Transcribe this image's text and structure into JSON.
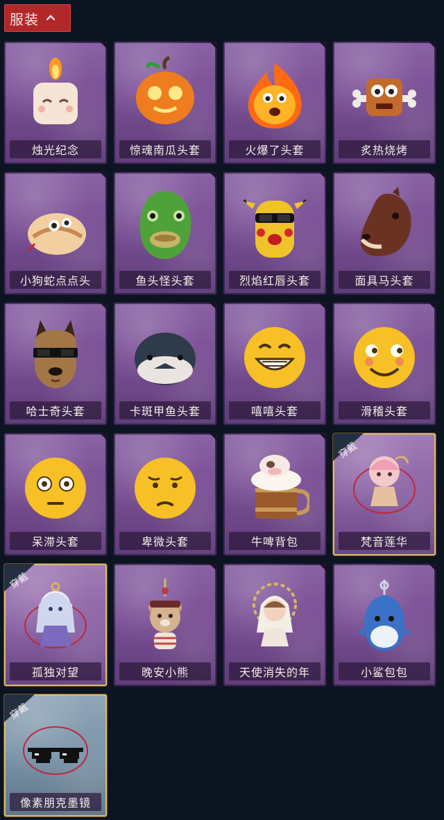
{
  "header": {
    "title": "服装"
  },
  "items": [
    {
      "label": "烛光纪念",
      "icon": "candle-icon",
      "equipped": false
    },
    {
      "label": "惊魂南瓜头套",
      "icon": "pumpkin-icon",
      "equipped": false
    },
    {
      "label": "火爆了头套",
      "icon": "fire-icon",
      "equipped": false
    },
    {
      "label": "炙热烧烤",
      "icon": "bbq-icon",
      "equipped": false
    },
    {
      "label": "小狗蛇点点头",
      "icon": "snake-icon",
      "equipped": false
    },
    {
      "label": "鱼头怪头套",
      "icon": "fish-head-icon",
      "equipped": false
    },
    {
      "label": "烈焰红唇头套",
      "icon": "pikachu-mask-icon",
      "equipped": false
    },
    {
      "label": "面具马头套",
      "icon": "horse-head-icon",
      "equipped": false
    },
    {
      "label": "哈士奇头套",
      "icon": "husky-head-icon",
      "equipped": false
    },
    {
      "label": "卡斑甲鱼头套",
      "icon": "fish-head-icon",
      "equipped": false
    },
    {
      "label": "嘻嘻头套",
      "icon": "grin-emoji-icon",
      "equipped": false
    },
    {
      "label": "滑稽头套",
      "icon": "smirk-emoji-icon",
      "equipped": false
    },
    {
      "label": "呆滞头套",
      "icon": "stunned-emoji-icon",
      "equipped": false
    },
    {
      "label": "卑微头套",
      "icon": "sad-emoji-icon",
      "equipped": false
    },
    {
      "label": "牛啤背包",
      "icon": "beer-backpack-icon",
      "equipped": false
    },
    {
      "label": "梵音莲华",
      "icon": "charm-character-icon",
      "equipped": true,
      "badge": "穿戴"
    },
    {
      "label": "孤独对望",
      "icon": "charm-character-icon",
      "equipped": true,
      "badge": "穿戴"
    },
    {
      "label": "晚安小熊",
      "icon": "bear-charm-icon",
      "equipped": false
    },
    {
      "label": "天使消失的年",
      "icon": "angel-charm-icon",
      "equipped": false
    },
    {
      "label": "小鲨包包",
      "icon": "shark-charm-icon",
      "equipped": false
    },
    {
      "label": "像素朋克墨镜",
      "icon": "pixel-sunglasses-icon",
      "equipped": true,
      "badge": "穿戴"
    }
  ]
}
